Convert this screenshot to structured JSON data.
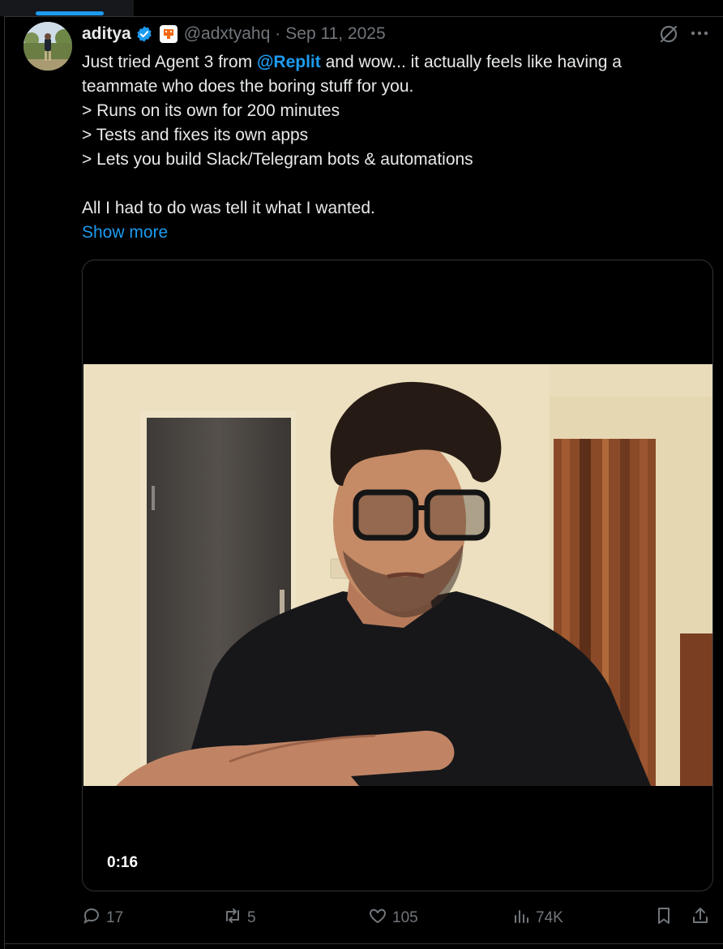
{
  "author": {
    "display_name": "aditya",
    "handle": "@adxtyahq",
    "separator": "·",
    "date": "Sep 11, 2025"
  },
  "tweet": {
    "line1_before": "Just tried Agent 3 from ",
    "line1_mention": "@Replit",
    "line1_after": " and wow... it actually feels like having a",
    "line2": "teammate who does the boring stuff for you.",
    "line3": "> Runs on its own for 200 minutes",
    "line4": "> Tests and fixes its own apps",
    "line5": "> Lets you build Slack/Telegram bots & automations",
    "line6": "",
    "line7": "All I had to do was tell it what I wanted.",
    "show_more": "Show more"
  },
  "video": {
    "duration": "0:16"
  },
  "actions": {
    "replies": "17",
    "reposts": "5",
    "likes": "105",
    "views": "74K"
  },
  "colors": {
    "accent": "#1d9bf0",
    "text": "#e7e9ea",
    "muted": "#71767b",
    "background": "#000000",
    "border": "#2f3336"
  },
  "icons": [
    "verified-icon",
    "affiliate-badge-icon",
    "grok-icon",
    "more-icon",
    "reply-icon",
    "repost-icon",
    "like-icon",
    "views-icon",
    "bookmark-icon",
    "share-icon"
  ]
}
